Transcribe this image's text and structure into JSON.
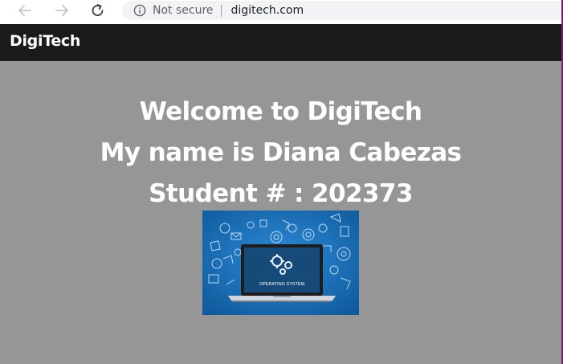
{
  "browser": {
    "security_label": "Not secure",
    "url": "digitech.com",
    "icons": {
      "back": "back-arrow-icon",
      "forward": "forward-arrow-icon",
      "reload": "reload-icon",
      "info": "info-icon"
    }
  },
  "navbar": {
    "brand": "DigiTech"
  },
  "hero": {
    "welcome": "Welcome to DigiTech",
    "name_line": "My name is Diana Cabezas",
    "student_line": "Student # : 202373"
  },
  "image": {
    "caption": "OPERATING SYSTEM"
  },
  "colors": {
    "page_background": "#969696",
    "navbar_background": "#1b1b1b",
    "text": "#ffffff",
    "image_blue": "#1a6fb5"
  }
}
